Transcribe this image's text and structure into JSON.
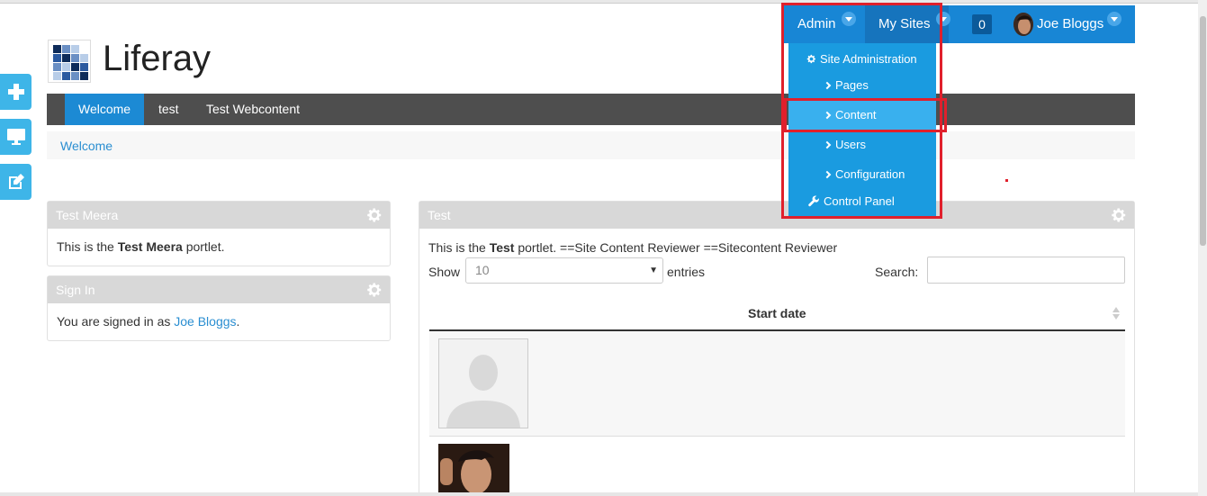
{
  "site": {
    "title": "Liferay"
  },
  "topbar": {
    "admin_label": "Admin",
    "mysites_label": "My Sites",
    "notification_count": "0",
    "user_name": "Joe Bloggs"
  },
  "admin_menu": {
    "items": [
      {
        "label": "Site Administration"
      },
      {
        "label": "Pages"
      },
      {
        "label": "Content"
      },
      {
        "label": "Users"
      },
      {
        "label": "Configuration"
      },
      {
        "label": "Control Panel"
      }
    ]
  },
  "nav": {
    "items": [
      {
        "label": "Welcome"
      },
      {
        "label": "test"
      },
      {
        "label": "Test Webcontent"
      }
    ]
  },
  "breadcrumb": {
    "current": "Welcome"
  },
  "portlets": {
    "test_meera": {
      "title": "Test Meera",
      "body_prefix": "This is the ",
      "body_bold": "Test Meera",
      "body_suffix": " portlet."
    },
    "sign_in": {
      "title": "Sign In",
      "body_prefix": "You are signed in as ",
      "body_link": "Joe Bloggs",
      "body_suffix": "."
    },
    "test": {
      "title": "Test",
      "body_prefix": "This is the ",
      "body_bold": "Test",
      "body_suffix": " portlet. ==Site Content Reviewer ==Sitecontent Reviewer",
      "show_label": "Show",
      "entries_value": "10",
      "entries_label": "entries",
      "search_label": "Search:",
      "search_value": "",
      "column_header": "Start date"
    }
  },
  "colors": {
    "accent": "#1886d5",
    "nav_active": "#1c8ad4",
    "dropdown": "#1a9be0",
    "highlight_box": "#e0202c"
  }
}
